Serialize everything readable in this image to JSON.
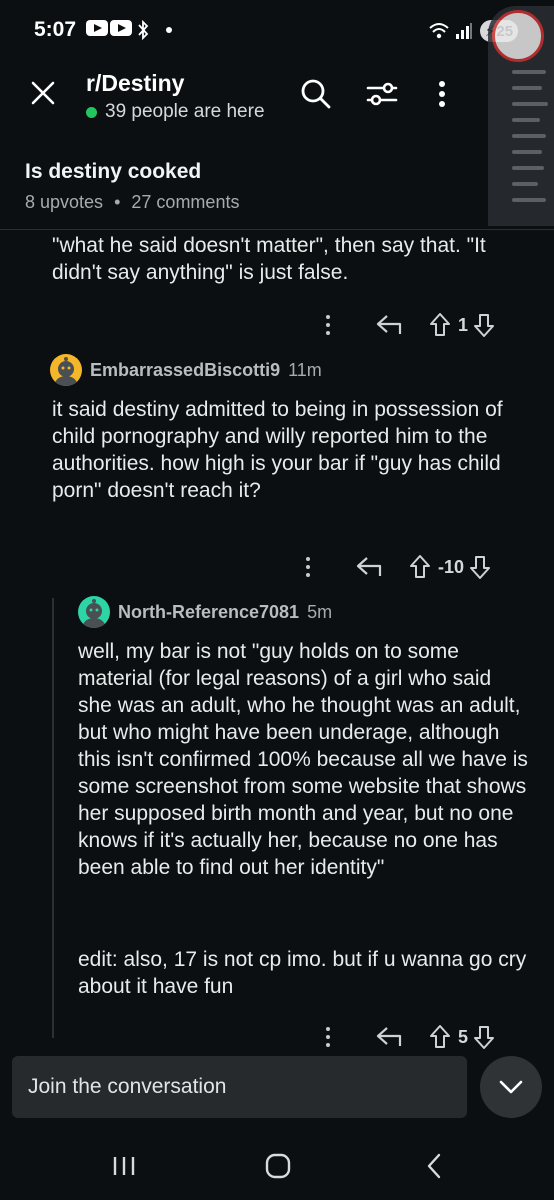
{
  "status_bar": {
    "time": "5:07",
    "battery": "25"
  },
  "header": {
    "subreddit": "r/Destiny",
    "online_text": "39 people are here"
  },
  "post": {
    "title": "Is destiny cooked",
    "upvotes": "8 upvotes",
    "separator": "•",
    "comments": "27 comments"
  },
  "comments": [
    {
      "text": "\"what he said doesn't matter\", then say that. \"It didn't say anything\" is just false.",
      "score": "1"
    },
    {
      "username": "EmbarrassedBiscotti9",
      "time": "11m",
      "text": "it said destiny admitted to being in possession of child pornography and willy reported him to the authorities. how high is your bar if \"guy has child porn\" doesn't reach it?",
      "score": "-10",
      "avatar_color": "#f5b72a"
    },
    {
      "username": "North-Reference7081",
      "time": "5m",
      "text": "well, my bar is not \"guy holds on to some material (for legal reasons) of a girl who said she was an adult, who he thought was an adult, but who might have been underage, although this isn't confirmed 100% because all we have is some screenshot from some website that shows her supposed birth month and year, but no one knows if it's actually her, because no one has been able to find out her identity\"",
      "text2": "edit: also, 17 is not cp imo. but if u wanna go cry about it have fun",
      "score": "5",
      "avatar_color": "#2dd4a6"
    }
  ],
  "composer": {
    "placeholder": "Join the conversation"
  },
  "colors": {
    "online": "#22c55e",
    "background": "#0b0f11"
  }
}
